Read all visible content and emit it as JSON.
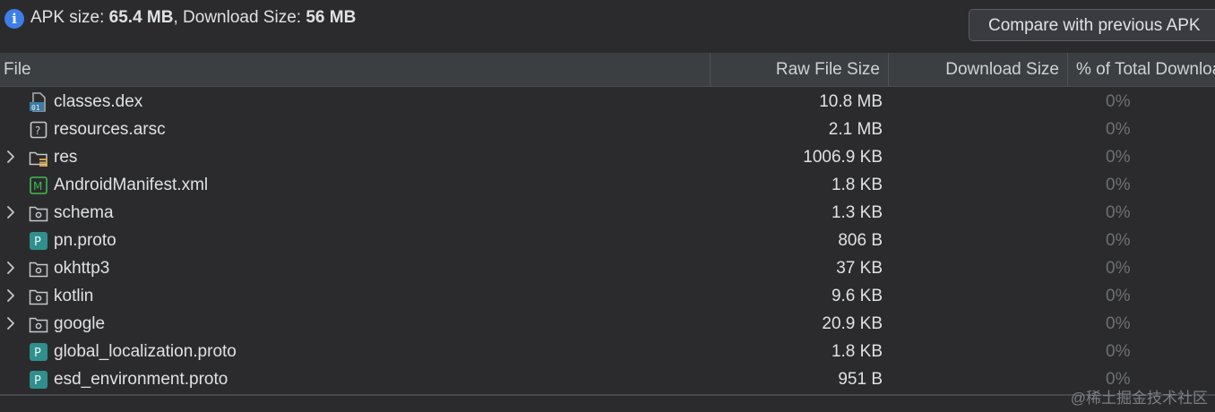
{
  "summary": {
    "apk_label": "APK size: ",
    "apk_value": "65.4 MB",
    "sep": ", ",
    "download_label": "Download Size: ",
    "download_value": "56 MB"
  },
  "compare_button": "Compare with previous APK",
  "columns": {
    "file": "File",
    "raw": "Raw File Size",
    "download": "Download Size",
    "percent": "% of Total Download Size"
  },
  "rows": [
    {
      "name": "classes.dex",
      "raw": "10.8 MB",
      "pct": "0%",
      "icon": "dex-file-icon",
      "expandable": false
    },
    {
      "name": "resources.arsc",
      "raw": "2.1 MB",
      "pct": "0%",
      "icon": "unknown-file-icon",
      "expandable": false
    },
    {
      "name": "res",
      "raw": "1006.9 KB",
      "pct": "0%",
      "icon": "resource-folder-icon",
      "expandable": true
    },
    {
      "name": "AndroidManifest.xml",
      "raw": "1.8 KB",
      "pct": "0%",
      "icon": "manifest-file-icon",
      "expandable": false
    },
    {
      "name": "schema",
      "raw": "1.3 KB",
      "pct": "0%",
      "icon": "package-folder-icon",
      "expandable": true
    },
    {
      "name": "pn.proto",
      "raw": "806 B",
      "pct": "0%",
      "icon": "proto-file-icon",
      "expandable": false
    },
    {
      "name": "okhttp3",
      "raw": "37 KB",
      "pct": "0%",
      "icon": "package-folder-icon",
      "expandable": true
    },
    {
      "name": "kotlin",
      "raw": "9.6 KB",
      "pct": "0%",
      "icon": "package-folder-icon",
      "expandable": true
    },
    {
      "name": "google",
      "raw": "20.9 KB",
      "pct": "0%",
      "icon": "package-folder-icon",
      "expandable": true
    },
    {
      "name": "global_localization.proto",
      "raw": "1.8 KB",
      "pct": "0%",
      "icon": "proto-file-icon",
      "expandable": false
    },
    {
      "name": "esd_environment.proto",
      "raw": "951 B",
      "pct": "0%",
      "icon": "proto-file-icon",
      "expandable": false
    }
  ],
  "watermark": "@稀土掘金技术社区",
  "colors": {
    "background": "#2b2b2d",
    "header": "#3c3f41",
    "info_blue": "#3d7ee8",
    "proto_teal": "#2f8f8c",
    "manifest_green": "#3fb950"
  }
}
